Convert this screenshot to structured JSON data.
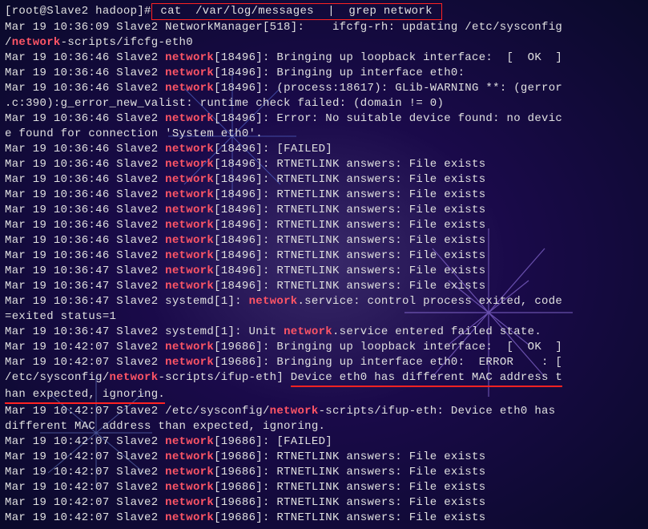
{
  "prompt": "[root@Slave2 hadoop]#",
  "command": " cat  /var/log/messages  |  grep network ",
  "hl": "network",
  "lines": [
    {
      "t": "plain",
      "pre": "Mar 19 10:36:09 Slave2 NetworkManager[518]:    ifcfg-rh: updating /etc/sysconfig"
    },
    {
      "t": "hl",
      "pre": "/",
      "post": "-scripts/ifcfg-eth0"
    },
    {
      "t": "hl",
      "pre": "Mar 19 10:36:46 Slave2 ",
      "post": "[18496]: Bringing up loopback interface:  [  OK  ]"
    },
    {
      "t": "hl",
      "pre": "Mar 19 10:36:46 Slave2 ",
      "post": "[18496]: Bringing up interface eth0:"
    },
    {
      "t": "hl",
      "pre": "Mar 19 10:36:46 Slave2 ",
      "post": "[18496]: (process:18617): GLib-WARNING **: (gerror"
    },
    {
      "t": "plain",
      "pre": ".c:390):g_error_new_valist: runtime check failed: (domain != 0)"
    },
    {
      "t": "hl",
      "pre": "Mar 19 10:36:46 Slave2 ",
      "post": "[18496]: Error: No suitable device found: no devic"
    },
    {
      "t": "plain",
      "pre": "e found for connection 'System eth0'."
    },
    {
      "t": "hl",
      "pre": "Mar 19 10:36:46 Slave2 ",
      "post": "[18496]: [FAILED]"
    },
    {
      "t": "hl",
      "pre": "Mar 19 10:36:46 Slave2 ",
      "post": "[18496]: RTNETLINK answers: File exists"
    },
    {
      "t": "hl",
      "pre": "Mar 19 10:36:46 Slave2 ",
      "post": "[18496]: RTNETLINK answers: File exists"
    },
    {
      "t": "hl",
      "pre": "Mar 19 10:36:46 Slave2 ",
      "post": "[18496]: RTNETLINK answers: File exists"
    },
    {
      "t": "hl",
      "pre": "Mar 19 10:36:46 Slave2 ",
      "post": "[18496]: RTNETLINK answers: File exists"
    },
    {
      "t": "hl",
      "pre": "Mar 19 10:36:46 Slave2 ",
      "post": "[18496]: RTNETLINK answers: File exists"
    },
    {
      "t": "hl",
      "pre": "Mar 19 10:36:46 Slave2 ",
      "post": "[18496]: RTNETLINK answers: File exists"
    },
    {
      "t": "hl",
      "pre": "Mar 19 10:36:46 Slave2 ",
      "post": "[18496]: RTNETLINK answers: File exists"
    },
    {
      "t": "hl",
      "pre": "Mar 19 10:36:47 Slave2 ",
      "post": "[18496]: RTNETLINK answers: File exists"
    },
    {
      "t": "hl",
      "pre": "Mar 19 10:36:47 Slave2 ",
      "post": "[18496]: RTNETLINK answers: File exists"
    },
    {
      "t": "hl2",
      "pre": "Mar 19 10:36:47 Slave2 systemd[1]: ",
      "post": ".service: control process exited, code"
    },
    {
      "t": "plain",
      "pre": "=exited status=1"
    },
    {
      "t": "hl2",
      "pre": "Mar 19 10:36:47 Slave2 systemd[1]: Unit ",
      "post": ".service entered failed state."
    },
    {
      "t": "hl",
      "pre": "Mar 19 10:42:07 Slave2 ",
      "post": "[19686]: Bringing up loopback interface:  [  OK  ]"
    },
    {
      "t": "hl",
      "pre": "Mar 19 10:42:07 Slave2 ",
      "post": "[19686]: Bringing up interface eth0:  ERROR    : ["
    },
    {
      "t": "hlul",
      "pre": "/etc/sysconfig/",
      "post": "-scripts/ifup-eth] ",
      "ul": "Device eth0 has different MAC address t"
    },
    {
      "t": "ul",
      "ul": "han expected, ignoring."
    },
    {
      "t": "hl2",
      "pre": "Mar 19 10:42:07 Slave2 /etc/sysconfig/",
      "post": "-scripts/ifup-eth: Device eth0 has "
    },
    {
      "t": "plain",
      "pre": "different MAC address than expected, ignoring."
    },
    {
      "t": "hl",
      "pre": "Mar 19 10:42:07 Slave2 ",
      "post": "[19686]: [FAILED]"
    },
    {
      "t": "hl",
      "pre": "Mar 19 10:42:07 Slave2 ",
      "post": "[19686]: RTNETLINK answers: File exists"
    },
    {
      "t": "hl",
      "pre": "Mar 19 10:42:07 Slave2 ",
      "post": "[19686]: RTNETLINK answers: File exists"
    },
    {
      "t": "hl",
      "pre": "Mar 19 10:42:07 Slave2 ",
      "post": "[19686]: RTNETLINK answers: File exists"
    },
    {
      "t": "hl",
      "pre": "Mar 19 10:42:07 Slave2 ",
      "post": "[19686]: RTNETLINK answers: File exists"
    },
    {
      "t": "hl",
      "pre": "Mar 19 10:42:07 Slave2 ",
      "post": "[19686]: RTNETLINK answers: File exists"
    }
  ]
}
